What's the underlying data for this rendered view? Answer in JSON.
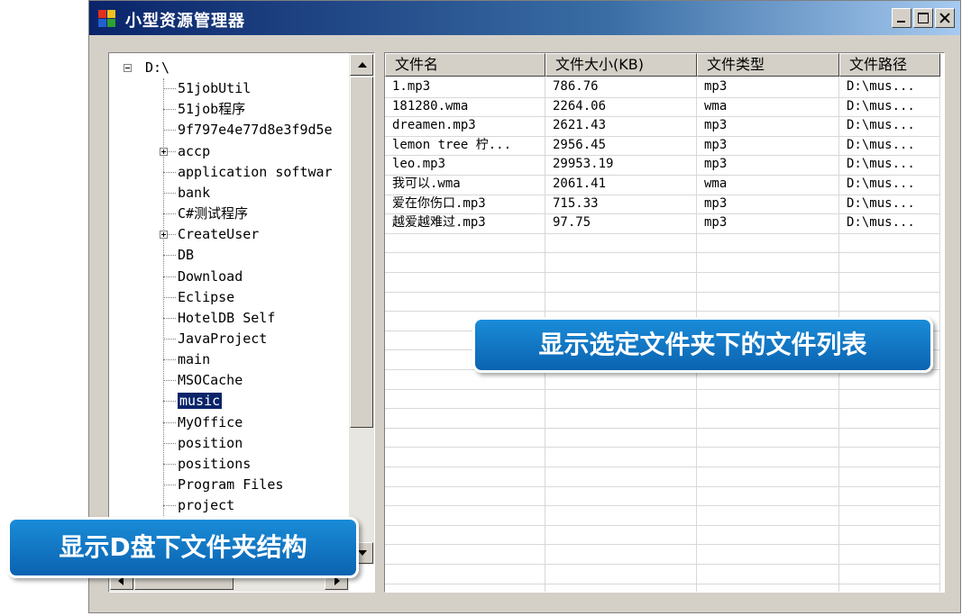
{
  "window": {
    "title": "小型资源管理器"
  },
  "tree": {
    "root": "D:\\",
    "items": [
      {
        "label": "51jobUtil",
        "expandable": false
      },
      {
        "label": "51job程序",
        "expandable": false
      },
      {
        "label": "9f797e4e77d8e3f9d5e",
        "expandable": false
      },
      {
        "label": "accp",
        "expandable": true
      },
      {
        "label": "application softwar",
        "expandable": false
      },
      {
        "label": "bank",
        "expandable": false
      },
      {
        "label": "C#测试程序",
        "expandable": false
      },
      {
        "label": "CreateUser",
        "expandable": true
      },
      {
        "label": "DB",
        "expandable": false
      },
      {
        "label": "Download",
        "expandable": false
      },
      {
        "label": "Eclipse",
        "expandable": false
      },
      {
        "label": "HotelDB Self",
        "expandable": false
      },
      {
        "label": "JavaProject",
        "expandable": false
      },
      {
        "label": "main",
        "expandable": false
      },
      {
        "label": "MSOCache",
        "expandable": false
      },
      {
        "label": "music",
        "expandable": false,
        "selected": true
      },
      {
        "label": "MyOffice",
        "expandable": false
      },
      {
        "label": "position",
        "expandable": false
      },
      {
        "label": "positions",
        "expandable": false
      },
      {
        "label": "Program Files",
        "expandable": false
      },
      {
        "label": "project",
        "expandable": false
      }
    ]
  },
  "list": {
    "columns": [
      "文件名",
      "文件大小(KB)",
      "文件类型",
      "文件路径"
    ],
    "rows": [
      [
        "1.mp3",
        "786.76",
        "mp3",
        "D:\\mus..."
      ],
      [
        "181280.wma",
        "2264.06",
        "wma",
        "D:\\mus..."
      ],
      [
        "dreamen.mp3",
        "2621.43",
        "mp3",
        "D:\\mus..."
      ],
      [
        "lemon tree 柠...",
        "2956.45",
        "mp3",
        "D:\\mus..."
      ],
      [
        "leo.mp3",
        "29953.19",
        "mp3",
        "D:\\mus..."
      ],
      [
        "我可以.wma",
        "2061.41",
        "wma",
        "D:\\mus..."
      ],
      [
        "爱在你伤口.mp3",
        "715.33",
        "mp3",
        "D:\\mus..."
      ],
      [
        "越爱越难过.mp3",
        "97.75",
        "mp3",
        "D:\\mus..."
      ]
    ]
  },
  "callouts": {
    "list": "显示选定文件夹下的文件列表",
    "tree": "显示D盘下文件夹结构"
  },
  "colors": {
    "selection": "#0a246a",
    "callout": "#0b63b0",
    "window_bg": "#d4d0c8"
  }
}
